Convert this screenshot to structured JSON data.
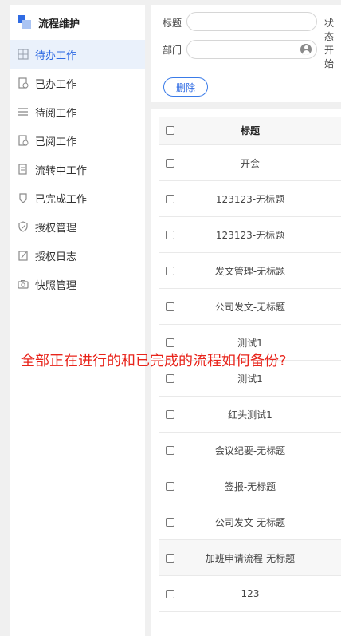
{
  "sidebar": {
    "title": "流程维护",
    "items": [
      {
        "label": "待办工作",
        "icon": "grid-icon"
      },
      {
        "label": "已办工作",
        "icon": "doc-check-icon"
      },
      {
        "label": "待阅工作",
        "icon": "list-icon"
      },
      {
        "label": "已阅工作",
        "icon": "doc-read-icon"
      },
      {
        "label": "流转中工作",
        "icon": "doc-flow-icon"
      },
      {
        "label": "已完成工作",
        "icon": "shield-check-icon"
      },
      {
        "label": "授权管理",
        "icon": "shield-icon"
      },
      {
        "label": "授权日志",
        "icon": "edit-log-icon"
      },
      {
        "label": "快照管理",
        "icon": "camera-icon"
      }
    ]
  },
  "filters": {
    "title_label": "标题",
    "status_label": "状态",
    "dept_label": "部门",
    "start_label": "开始",
    "delete_label": "删除"
  },
  "table": {
    "header_title": "标题",
    "rows": [
      "开会",
      "123123-无标题",
      "123123-无标题",
      "发文管理-无标题",
      "公司发文-无标题",
      "测试1",
      "测试1",
      "红头测试1",
      "会议纪要-无标题",
      "签报-无标题",
      "公司发文-无标题",
      "加班申请流程-无标题",
      "123"
    ]
  },
  "overlay_text": "全部正在进行的和已完成的流程如何备份?",
  "colors": {
    "accent": "#2f6be3",
    "overlay": "#e8241b"
  }
}
